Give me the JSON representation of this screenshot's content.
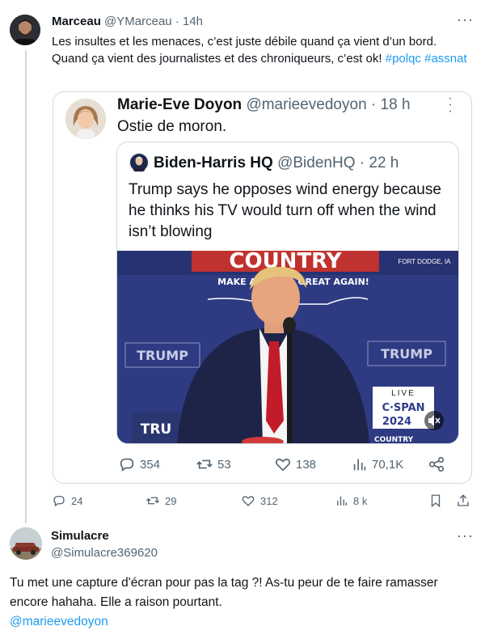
{
  "tweet": {
    "author_name": "Marceau",
    "author_handle": "@YMarceau",
    "time": "· 14h",
    "text": "Les insultes et les menaces, c’est juste débile quand ça vient d’un bord. Quand ça vient des journalistes et des chroniqueurs, c’est ok!",
    "hashtags": [
      "#polqc",
      "#assnat"
    ],
    "stats": {
      "replies": "24",
      "retweets": "29",
      "likes": "312",
      "views": "8 k"
    }
  },
  "quote": {
    "author_name": "Marie-Eve Doyon",
    "author_handle": "@marieevedoyon",
    "time": "· 18 h",
    "text": "Ostie de moron.",
    "stats": {
      "replies": "354",
      "retweets": "53",
      "likes": "138",
      "views": "70,1K"
    }
  },
  "inner_quote": {
    "author_name": "Biden-Harris HQ",
    "author_handle": "@BidenHQ",
    "time": "· 22 h",
    "text": "Trump says he opposes wind energy because he thinks his TV would turn off when the wind isn’t blowing",
    "media": {
      "banner_text": "COUNTRY",
      "slogan": "MAKE AMERICA GREAT AGAIN!",
      "sign_left": "TRUMP",
      "sign_right": "TRUMP",
      "location": "FORT DODGE, IA",
      "live_label": "LIVE",
      "network": "C·SPAN",
      "year": "2024"
    }
  },
  "reply": {
    "author_name": "Simulacre",
    "author_handle": "@Simulacre369620",
    "text": "Tu met une capture d'écran pour pas la tag ?! As-tu peur de te faire ramasser encore hahaha. Elle a raison pourtant.",
    "mention": "@marieevedoyon"
  },
  "colors": {
    "accent": "#1d9bf0",
    "muted": "#536471",
    "border": "#cfd9de"
  },
  "icons": [
    "reply-icon",
    "retweet-icon",
    "like-icon",
    "views-icon",
    "share-icon",
    "bookmark-icon",
    "more-icon",
    "mute-icon"
  ]
}
